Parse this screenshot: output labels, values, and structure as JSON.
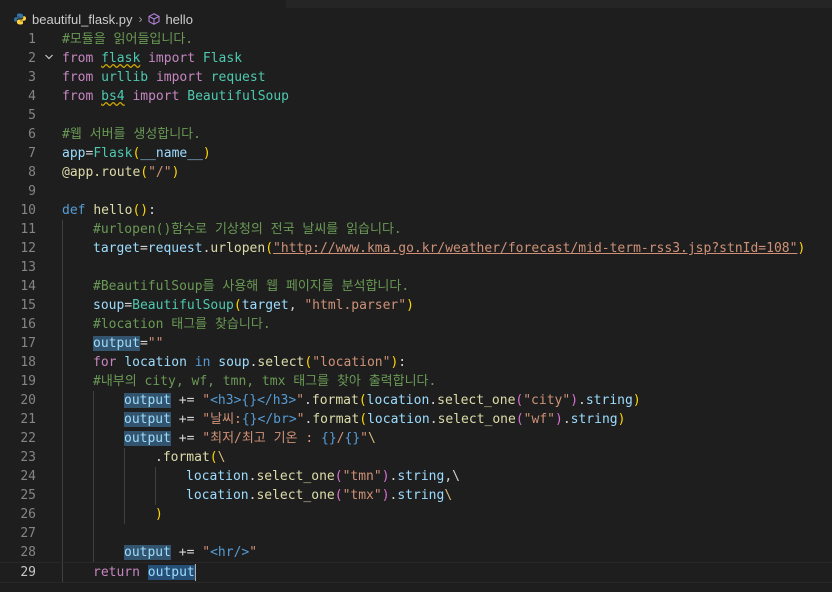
{
  "tab": {
    "filename": "beautiful_flask.py",
    "icon": "python-file-icon"
  },
  "breadcrumb": {
    "file": "beautiful_flask.py",
    "symbol": "hello",
    "separator": "›"
  },
  "editor": {
    "current_line": 29,
    "line_numbers": [
      "1",
      "2",
      "3",
      "4",
      "5",
      "6",
      "7",
      "8",
      "9",
      "10",
      "11",
      "12",
      "13",
      "14",
      "15",
      "16",
      "17",
      "18",
      "19",
      "20",
      "21",
      "22",
      "23",
      "24",
      "25",
      "26",
      "27",
      "28",
      "29"
    ],
    "lines": {
      "l1": {
        "c1": "#모듈을 읽어들입니다."
      },
      "l2": {
        "c1": "from",
        "c2": " ",
        "c3": "flask",
        "c4": " ",
        "c5": "import",
        "c6": " ",
        "c7": "Flask"
      },
      "l3": {
        "c1": "from",
        "c2": " ",
        "c3": "urllib",
        "c4": " ",
        "c5": "import",
        "c6": " ",
        "c7": "request"
      },
      "l4": {
        "c1": "from",
        "c2": " ",
        "c3": "bs4",
        "c4": " ",
        "c5": "import",
        "c6": " ",
        "c7": "BeautifulSoup"
      },
      "l6": {
        "c1": "#웹 서버를 생성합니다."
      },
      "l7": {
        "c1": "app",
        "c2": "=",
        "c3": "Flask",
        "c4": "(",
        "c5": "__name__",
        "c6": ")"
      },
      "l8": {
        "c1": "@app.route",
        "c2": "(",
        "c3": "\"/\"",
        "c4": ")"
      },
      "l10": {
        "c1": "def",
        "c2": " ",
        "c3": "hello",
        "c4": "()",
        "c5": ":"
      },
      "l11": {
        "c1": "#urlopen()함수로 기상청의 전국 날씨를 읽습니다."
      },
      "l12": {
        "c1": "target",
        "c2": "=",
        "c3": "request",
        "c4": ".",
        "c5": "urlopen",
        "c6": "(",
        "c7": "\"http://www.kma.go.kr/weather/forecast/mid-term-rss3.jsp?stnId=108\"",
        "c8": ")"
      },
      "l14": {
        "c1": "#BeautifulSoup를 사용해 웹 페이지를 분석합니다."
      },
      "l15": {
        "c1": "soup",
        "c2": "=",
        "c3": "BeautifulSoup",
        "c4": "(",
        "c5": "target",
        "c6": ", ",
        "c7": "\"html.parser\"",
        "c8": ")"
      },
      "l16": {
        "c1": "#location 태그를 찾습니다."
      },
      "l17": {
        "c1": "output",
        "c2": "=",
        "c3": "\"\""
      },
      "l18": {
        "c1": "for",
        "c2": " ",
        "c3": "location",
        "c4": " ",
        "c5": "in",
        "c6": " ",
        "c7": "soup",
        "c8": ".",
        "c9": "select",
        "c10": "(",
        "c11": "\"location\"",
        "c12": ")",
        "c13": ":"
      },
      "l19": {
        "c1": "#내부의 city, wf, tmn, tmx 태그를 찾아 출력합니다."
      },
      "l20": {
        "c1": "output",
        "c2": " += ",
        "c3": "\"",
        "c4": "<h3>",
        "c5": "{}",
        "c6": "</h3>",
        "c7": "\"",
        "c8": ".",
        "c9": "format",
        "c10": "(",
        "c11": "location",
        "c12": ".",
        "c13": "select_one",
        "c14": "(",
        "c15": "\"city\"",
        "c16": ")",
        "c17": ".",
        "c18": "string",
        "c19": ")"
      },
      "l21": {
        "c1": "output",
        "c2": " += ",
        "c3": "\"날씨:",
        "c4": "{}",
        "c5": "</br>",
        "c6": "\"",
        "c7": ".",
        "c8": "format",
        "c9": "(",
        "c10": "location",
        "c11": ".",
        "c12": "select_one",
        "c13": "(",
        "c14": "\"wf\"",
        "c15": ")",
        "c16": ".",
        "c17": "string",
        "c18": ")"
      },
      "l22": {
        "c1": "output",
        "c2": " += ",
        "c3": "\"최저/최고 기온 : ",
        "c4": "{}",
        "c5": "/",
        "c6": "{}",
        "c7": "\"",
        "c8": "\\"
      },
      "l23": {
        "c1": ".",
        "c2": "format",
        "c3": "(",
        "c4": "\\"
      },
      "l24": {
        "c1": "location",
        "c2": ".",
        "c3": "select_one",
        "c4": "(",
        "c5": "\"tmn\"",
        "c6": ")",
        "c7": ".",
        "c8": "string",
        "c9": ",\\"
      },
      "l25": {
        "c1": "location",
        "c2": ".",
        "c3": "select_one",
        "c4": "(",
        "c5": "\"tmx\"",
        "c6": ")",
        "c7": ".",
        "c8": "string",
        "c9": "\\"
      },
      "l26": {
        "c1": ")"
      },
      "l28": {
        "c1": "output",
        "c2": " += ",
        "c3": "\"",
        "c4": "<hr/>",
        "c5": "\""
      },
      "l29": {
        "c1": "return",
        "c2": " ",
        "c3": "output"
      }
    }
  }
}
